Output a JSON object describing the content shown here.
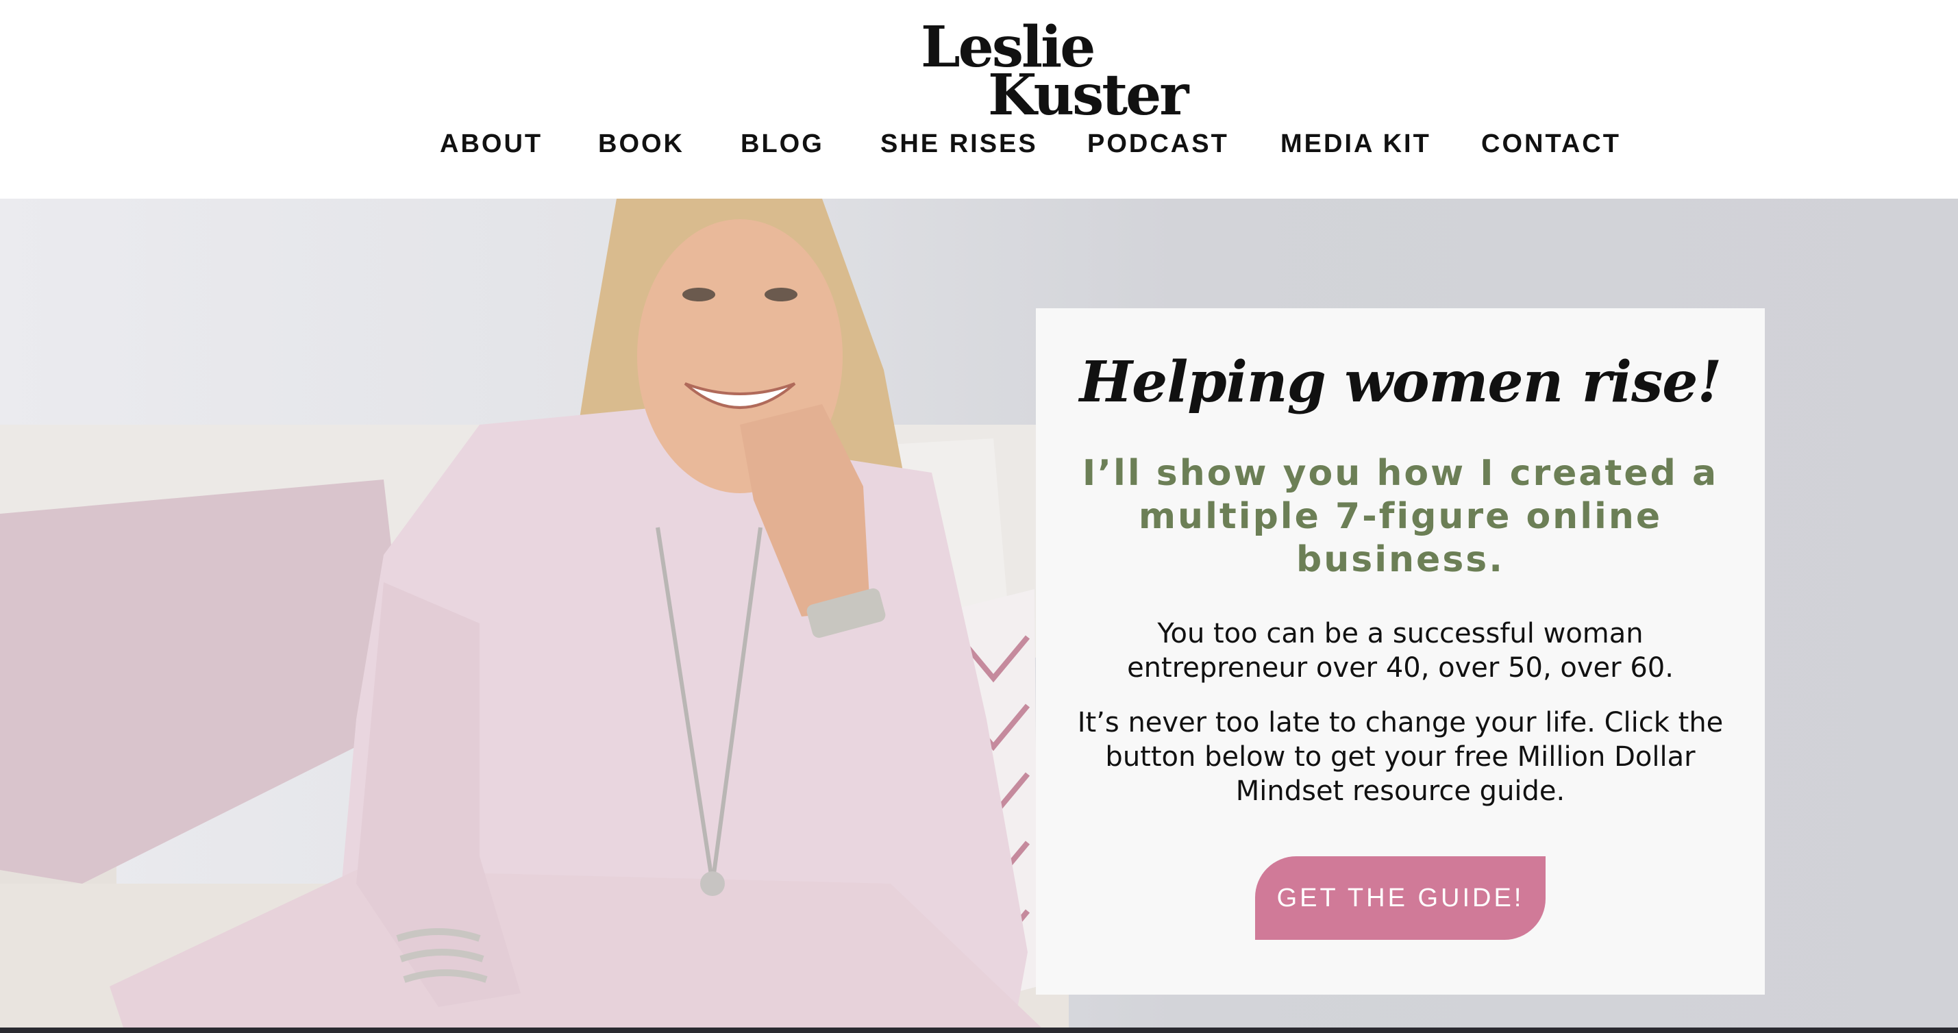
{
  "logo": {
    "line1": "Leslie",
    "line2": "Kuster"
  },
  "nav": {
    "items": [
      "ABOUT",
      "BOOK",
      "BLOG",
      "SHE RISES",
      "PODCAST",
      "MEDIA KIT",
      "CONTACT"
    ]
  },
  "hero": {
    "script_title": "Helping women rise!",
    "subheadline": "I’ll show you how I created a multiple 7-figure online business.",
    "paragraph1": "You too can be a successful woman entrepreneur over 40, over 50, over 60.",
    "paragraph2": "It’s never too late to change your life. Click the button below to get your free Million Dollar Mindset resource guide.",
    "cta_label": "GET THE GUIDE!"
  },
  "colors": {
    "accent_green": "#6c7f56",
    "cta_pink": "#d07a98",
    "outfit_pink": "#e9d6df"
  }
}
